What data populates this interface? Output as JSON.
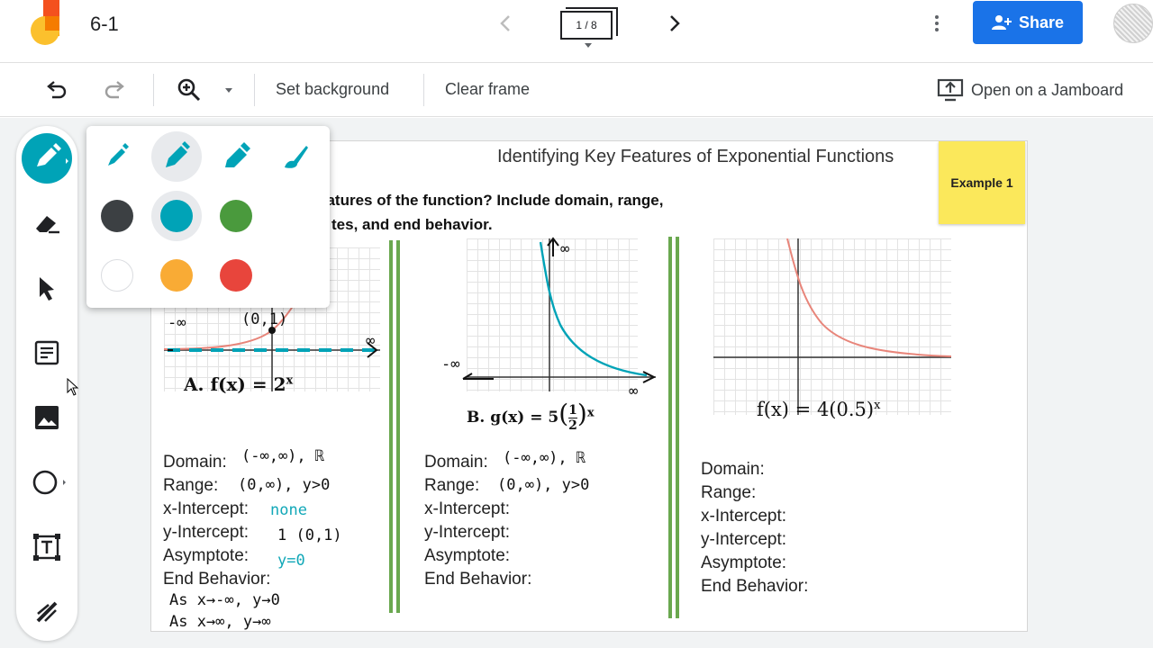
{
  "app": {
    "title": "6-1",
    "frame_counter": "1 / 8",
    "share_label": "Share"
  },
  "toolbar": {
    "set_background": "Set background",
    "clear_frame": "Clear frame",
    "open_on_jamboard": "Open on a Jamboard"
  },
  "colors": {
    "accent_blue": "#1a73e8",
    "pen_teal": "#00a3b7",
    "divider_green": "#6aa84f",
    "sticky_yellow": "#fbe85b"
  },
  "pen_popup": {
    "pen_types": [
      "pen-icon",
      "marker-icon",
      "highlighter-icon",
      "brush-icon"
    ],
    "colors": [
      "#3c4043",
      "#00a3b7",
      "#4a9a3d",
      "#ffffff",
      "#f9ab35",
      "#e8453c"
    ]
  },
  "worksheet": {
    "title": "Identifying Key Features of Exponential Functions",
    "question_line1": "eatures of the function? Include domain, range,",
    "question_line2": "tes, and end behavior.",
    "sticky": "Example 1",
    "panels": [
      {
        "function_label": "A. f(x) = 2",
        "exponent": "x",
        "features": [
          "Domain:",
          "Range:",
          "x-Intercept:",
          "y-Intercept:",
          "Asymptote:",
          "End Behavior:"
        ],
        "handwriting": {
          "domain": "(-∞,∞), ℝ",
          "range": "(0,∞), y>0",
          "x_intercept": "none",
          "y_intercept": "1   (0,1)",
          "asymptote": "y=0",
          "end1": "As x→-∞, y→0",
          "end2": "As x→∞, y→∞",
          "graph_left": "-∞",
          "graph_point": "(0,1)",
          "graph_right": "∞"
        }
      },
      {
        "function_label": "B. g(x) = 5",
        "fraction_num": "1",
        "fraction_den": "2",
        "exponent": "x",
        "features": [
          "Domain:",
          "Range:",
          "x-Intercept:",
          "y-Intercept:",
          "Asymptote:",
          "End Behavior:"
        ],
        "handwriting": {
          "domain": "(-∞,∞), ℝ",
          "range": "(0,∞), y>0",
          "graph_top": "∞",
          "graph_left": "-∞",
          "graph_right": "∞"
        }
      },
      {
        "function_label": "f(x) = 4(0.5)",
        "exponent": "x",
        "features": [
          "Domain:",
          "Range:",
          "x-Intercept:",
          "y-Intercept:",
          "Asymptote:",
          "End Behavior:"
        ]
      }
    ]
  }
}
